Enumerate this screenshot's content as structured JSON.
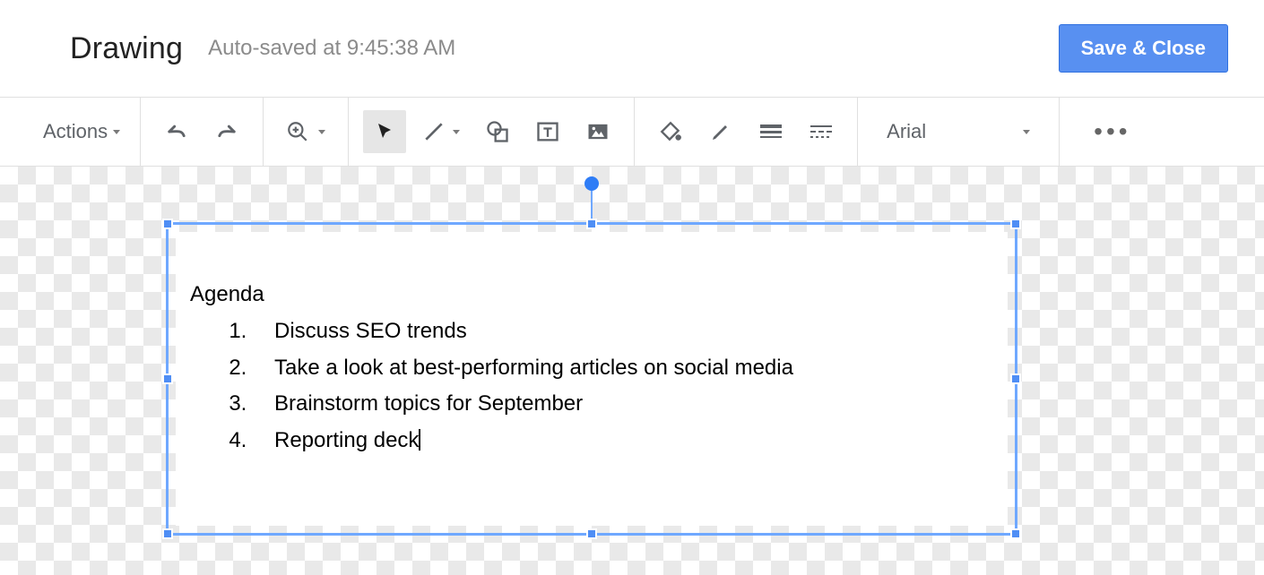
{
  "header": {
    "title": "Drawing",
    "autosave": "Auto-saved at 9:45:38 AM",
    "save_close": "Save & Close"
  },
  "toolbar": {
    "actions_label": "Actions",
    "font": "Arial"
  },
  "textbox": {
    "heading": "Agenda",
    "items": [
      "Discuss SEO trends",
      "Take a look at best-performing articles on social media",
      "Brainstorm topics for September",
      "Reporting deck"
    ]
  }
}
